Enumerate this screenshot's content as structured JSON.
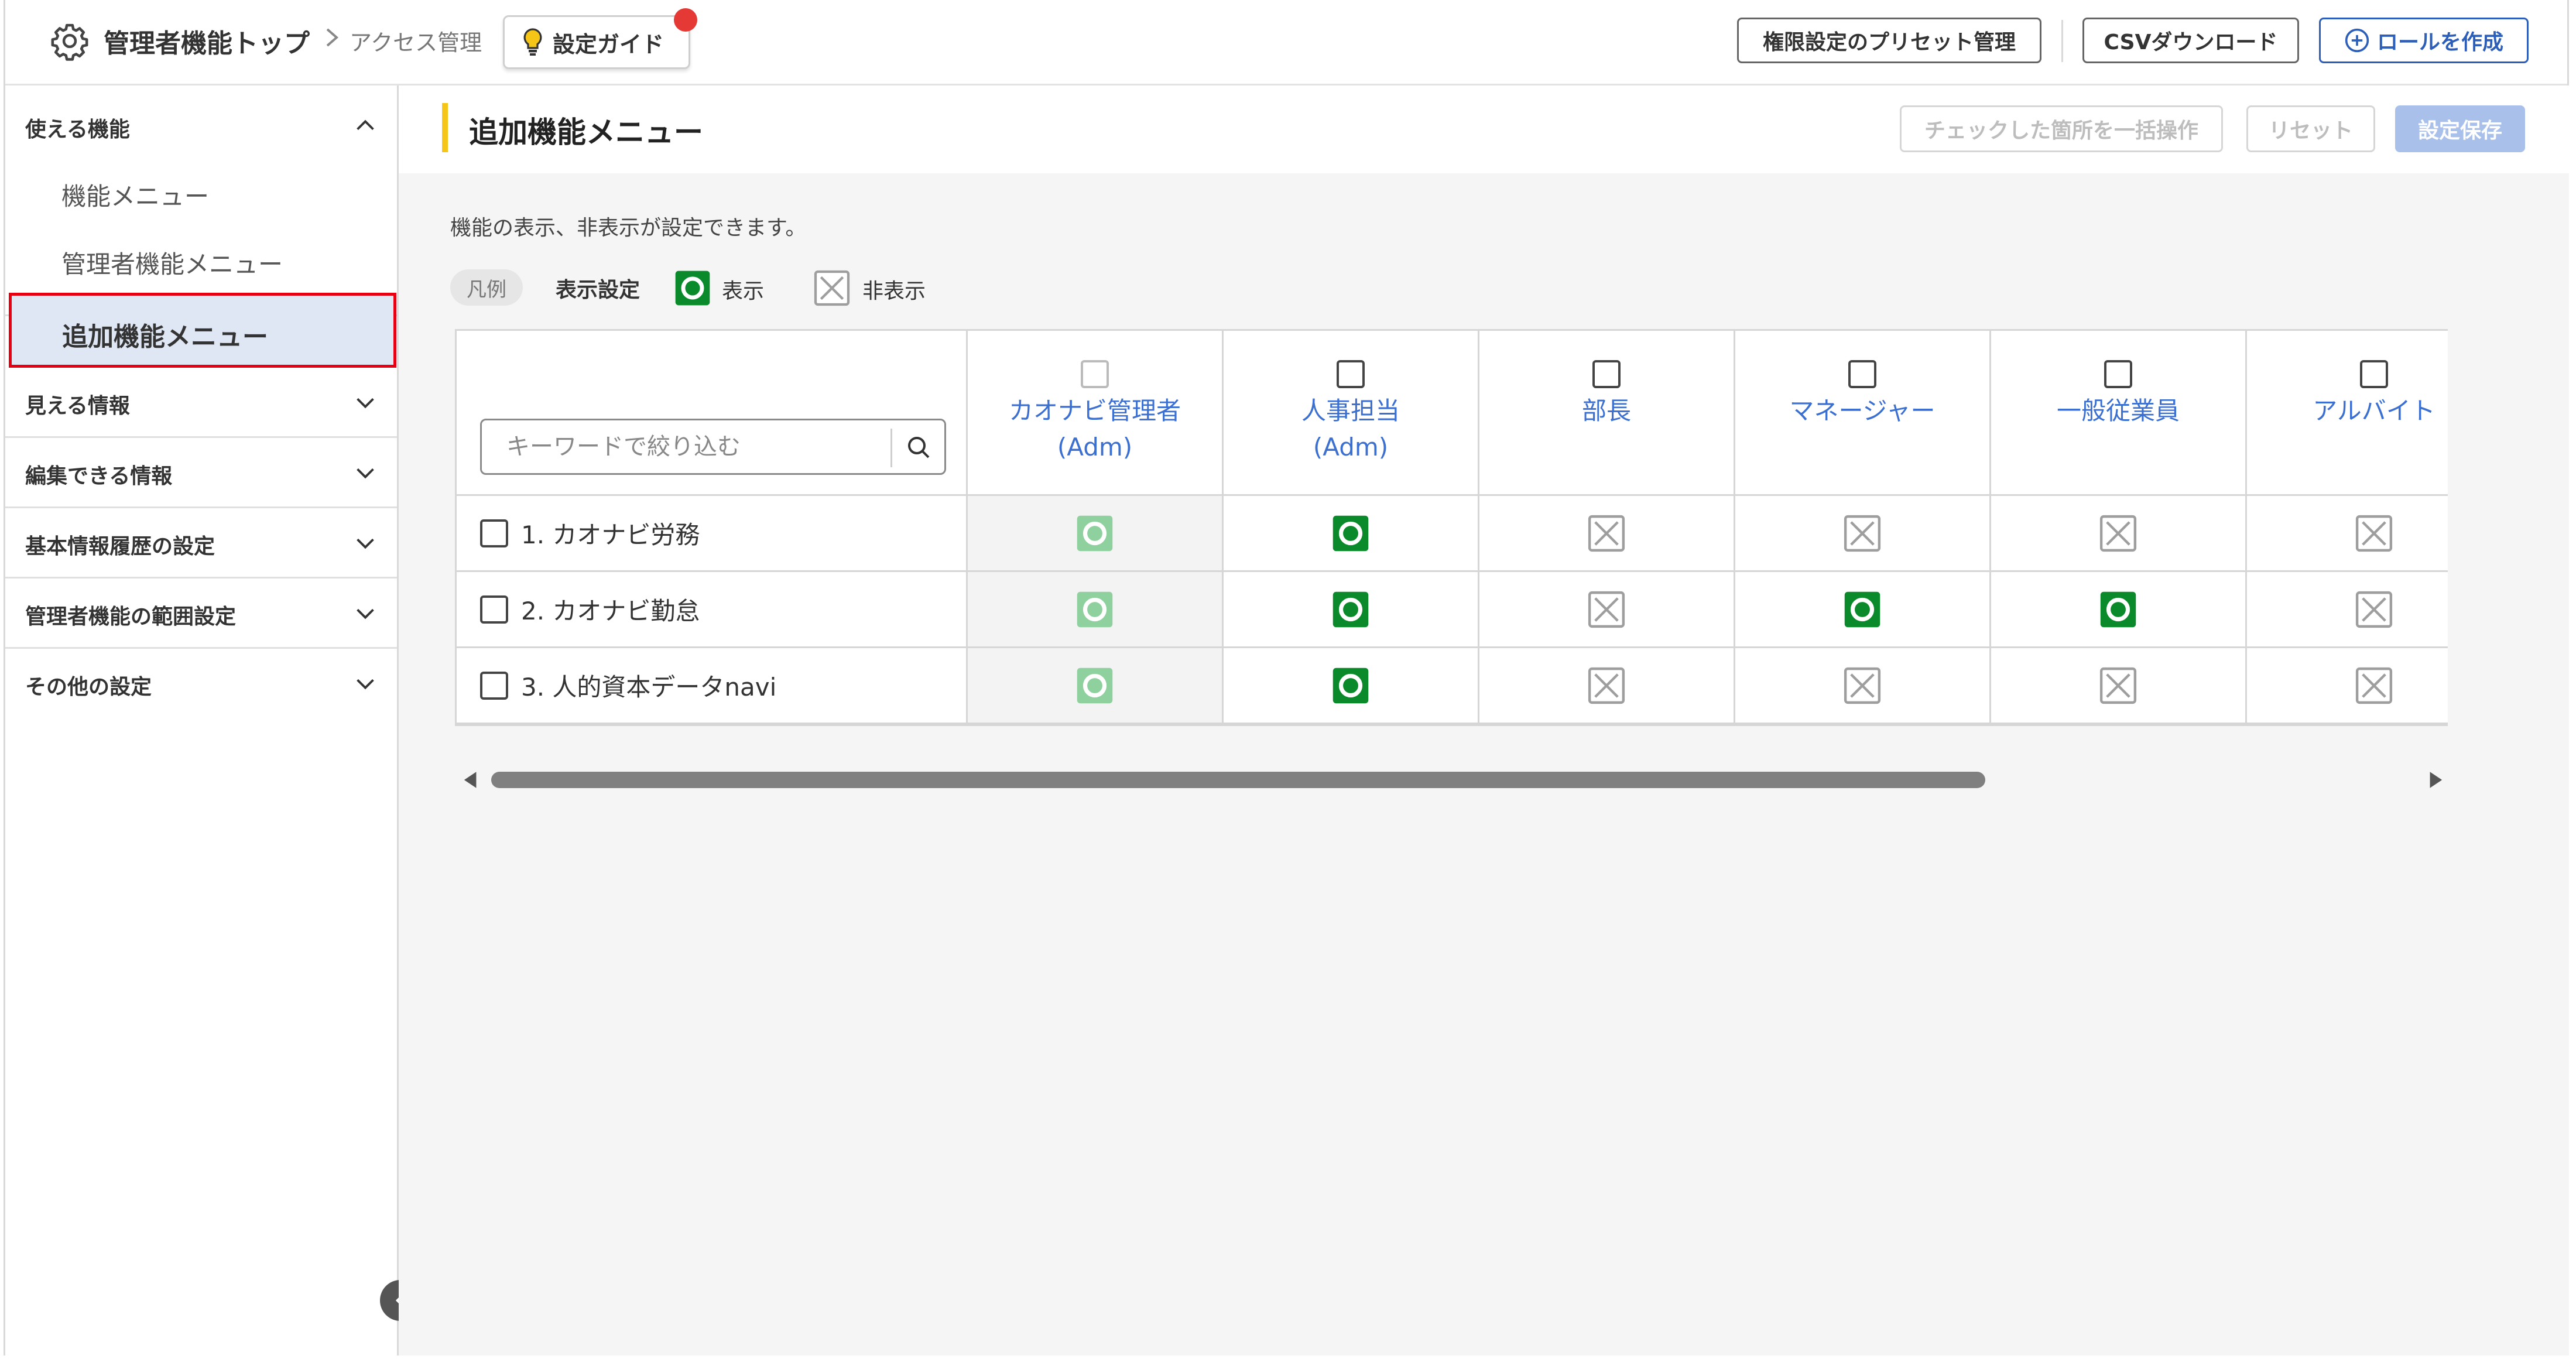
{
  "header": {
    "breadcrumb_main": "管理者機能トップ",
    "breadcrumb_sub": "アクセス管理",
    "guide_label": "設定ガイド",
    "preset_label": "権限設定のプリセット管理",
    "csv_label": "CSVダウンロード",
    "create_label": "ロールを作成"
  },
  "sidebar": {
    "sections": [
      {
        "title": "使える機能",
        "expanded": true,
        "items": [
          "機能メニュー",
          "管理者機能メニュー",
          "追加機能メニュー"
        ],
        "active_item": "追加機能メニュー"
      },
      {
        "title": "見える情報",
        "expanded": false
      },
      {
        "title": "編集できる情報",
        "expanded": false
      },
      {
        "title": "基本情報履歴の設定",
        "expanded": false
      },
      {
        "title": "管理者機能の範囲設定",
        "expanded": false
      },
      {
        "title": "その他の設定",
        "expanded": false
      }
    ]
  },
  "main": {
    "title": "追加機能メニュー",
    "bulk_label": "チェックした箇所を一括操作",
    "reset_label": "リセット",
    "save_label": "設定保存",
    "description": "機能の表示、非表示が設定できます。",
    "legend": {
      "tag": "凡例",
      "label": "表示設定",
      "show": "表示",
      "hide": "非表示"
    },
    "search": {
      "placeholder": "キーワードで絞り込む"
    },
    "roles": [
      {
        "line1": "カオナビ管理者",
        "line2": "(Adm)",
        "checkbox_disabled": true
      },
      {
        "line1": "人事担当",
        "line2": "(Adm)",
        "checkbox_disabled": false
      },
      {
        "line1": "部長",
        "line2": "",
        "checkbox_disabled": false
      },
      {
        "line1": "マネージャー",
        "line2": "",
        "checkbox_disabled": false
      },
      {
        "line1": "一般従業員",
        "line2": "",
        "checkbox_disabled": false
      },
      {
        "line1": "アルバイト",
        "line2": "",
        "checkbox_disabled": false
      }
    ],
    "rows": [
      {
        "name": "1. カオナビ労務",
        "values": [
          "show-locked",
          "show",
          "hide",
          "hide",
          "hide",
          "hide"
        ]
      },
      {
        "name": "2. カオナビ勤怠",
        "values": [
          "show-locked",
          "show",
          "hide",
          "show",
          "show",
          "hide"
        ]
      },
      {
        "name": "3. 人的資本データnavi",
        "values": [
          "show-locked",
          "show",
          "hide",
          "hide",
          "hide",
          "hide"
        ]
      }
    ],
    "scrollbar_position": 0
  },
  "colors": {
    "accent_blue": "#2e5fb8",
    "show_green": "#0a8a2a",
    "show_locked_green": "#8fd19e",
    "hide_gray": "#9e9e9e",
    "active_bg": "#dfe7f5",
    "highlight_red": "#e60012",
    "title_accent": "#f5c518"
  },
  "icons": {
    "header": [
      "gear-icon",
      "chevron-right-icon",
      "lightbulb-icon",
      "plus-circle-icon"
    ],
    "table": [
      "search-icon",
      "circle-show-icon",
      "x-hide-icon"
    ],
    "sidebar": [
      "chevron-up-icon",
      "chevron-down-icon",
      "chevron-left-icon"
    ]
  }
}
